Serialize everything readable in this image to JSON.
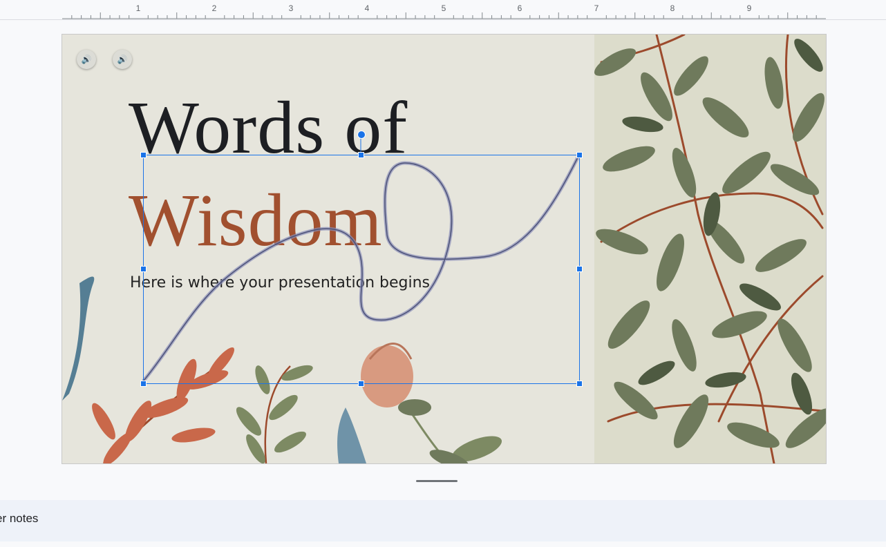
{
  "ruler": {
    "numbers": [
      "1",
      "2",
      "3",
      "4",
      "5",
      "6",
      "7",
      "8",
      "9"
    ]
  },
  "slide": {
    "title_line1": "Words of",
    "title_line2": "Wisdom",
    "subtitle": "Here is where your presentation begins",
    "audio_buttons": [
      {
        "icon": "speaker-icon",
        "glyph": "🔊"
      },
      {
        "icon": "speaker-icon",
        "glyph": "🔊"
      }
    ],
    "colors": {
      "background": "#e6e5dc",
      "title_dark": "#1d1f23",
      "title_accent": "#a1502f",
      "selection": "#1a73e8",
      "leaf_green": "#6f7a5c",
      "leaf_dark": "#4e5a41",
      "stem_red": "#9c4a2c",
      "coral": "#c9684a",
      "teal": "#557e94",
      "pattern_bg": "#dcdccb"
    }
  },
  "speaker_notes": {
    "label": "er notes"
  }
}
